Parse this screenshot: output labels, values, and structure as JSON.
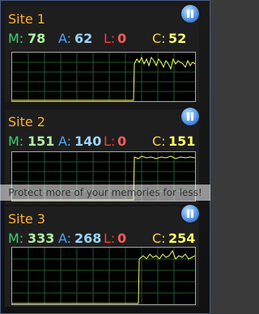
{
  "sites": [
    {
      "title": "Site 1",
      "m_label": "M:",
      "m": "78",
      "a_label": "A:",
      "a": "62",
      "l_label": "L:",
      "l": "0",
      "c_label": "C:",
      "c": "52"
    },
    {
      "title": "Site 2",
      "m_label": "M:",
      "m": "151",
      "a_label": "A:",
      "a": "140",
      "l_label": "L:",
      "l": "0",
      "c_label": "C:",
      "c": "151"
    },
    {
      "title": "Site 3",
      "m_label": "M:",
      "m": "333",
      "a_label": "A:",
      "a": "268",
      "l_label": "L:",
      "l": "0",
      "c_label": "C:",
      "c": "254"
    }
  ],
  "overlay": {
    "text": "Protect more of your memories for less!"
  },
  "colors": {
    "accent_title": "#ffb02e",
    "graph_line": "#ffff66",
    "grid": "#1f5a2a"
  },
  "icons": {
    "pause": "pause-icon"
  }
}
